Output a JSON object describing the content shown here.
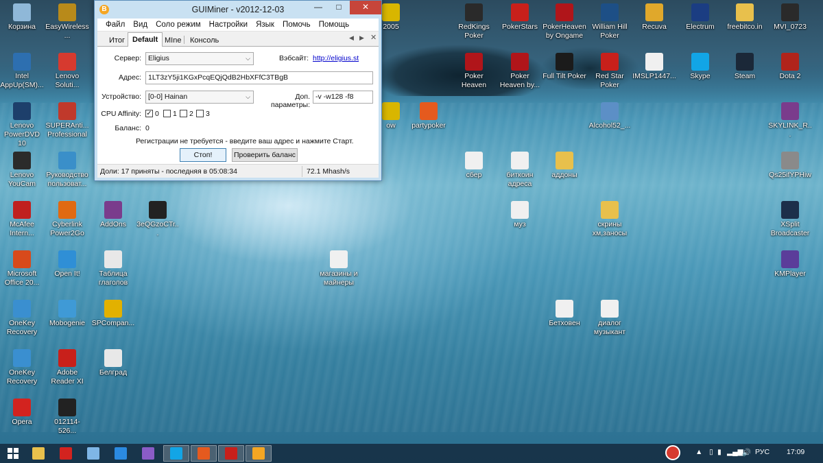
{
  "window": {
    "title": "GUIMiner - v2012-12-03",
    "menu": [
      "Файл",
      "Вид",
      "Соло режим",
      "Настройки",
      "Язык",
      "Помочь",
      "Помощь"
    ],
    "tabs": [
      "Итог",
      "Default",
      "MIne",
      "Консоль"
    ],
    "active_tab": "Default",
    "form": {
      "server_label": "Сервер:",
      "server_value": "Eligius",
      "website_label": "Вэбсайт:",
      "website_link": "http://eligius.st",
      "address_label": "Адрес:",
      "address_value": "1LT3zY5ji1KGxPcqEQjQdB2HbXFfC3TBgB",
      "device_label": "Устройство:",
      "device_value": "[0-0] Hainan",
      "extra_label": "Доп. параметры:",
      "extra_value": "-v -w128 -f8",
      "affinity_label": "CPU Affinity:",
      "affinity": [
        {
          "label": "0",
          "checked": true
        },
        {
          "label": "1",
          "checked": false
        },
        {
          "label": "2",
          "checked": false
        },
        {
          "label": "3",
          "checked": false
        }
      ],
      "balance_label": "Баланс:",
      "balance_value": "0",
      "note": "Регистрации не требуется - введите ваш адрес и нажмите Старт.",
      "stop_button": "Стоп!",
      "check_balance_button": "Проверить баланс"
    },
    "status": {
      "shares": "Доли: 17 приняты - последняя в 05:08:34",
      "hashrate": "72.1 Mhash/s"
    }
  },
  "desktop_icons": [
    {
      "label": "Корзина",
      "icon": "recycle-bin-icon",
      "color": "#8fb8d8"
    },
    {
      "label": "EasyWireless...",
      "icon": "wireless-app-icon",
      "color": "#b88a1a"
    },
    {
      "label": "Intel AppUp(SM)...",
      "icon": "intel-appup-icon",
      "color": "#2d6fb0"
    },
    {
      "label": "Lenovo Soluti...",
      "icon": "lenovo-solutions-icon",
      "color": "#d63a2f"
    },
    {
      "label": "Lenovo PowerDVD 10",
      "icon": "powerdvd-icon",
      "color": "#1d3f6b"
    },
    {
      "label": "SUPERAnti... Professional",
      "icon": "superantispyware-icon",
      "color": "#c0392b"
    },
    {
      "label": "Lenovo YouCam",
      "icon": "youcam-icon",
      "color": "#2b2b2b"
    },
    {
      "label": "Руководство пользоват...",
      "icon": "user-guide-icon",
      "color": "#3a8fc9"
    },
    {
      "label": "McAfee Intern...",
      "icon": "mcafee-icon",
      "color": "#c0201f"
    },
    {
      "label": "Cyberlink Power2Go",
      "icon": "power2go-icon",
      "color": "#e06a12"
    },
    {
      "label": "AddOns",
      "icon": "winrar-icon",
      "color": "#7a3c8c"
    },
    {
      "label": "3eQGzoCTr...",
      "icon": "video-file-icon",
      "color": "#222222"
    },
    {
      "label": "Microsoft Office 20...",
      "icon": "office-icon",
      "color": "#d84a1b"
    },
    {
      "label": "Open It!",
      "icon": "open-it-icon",
      "color": "#2f8fd6"
    },
    {
      "label": "Таблица глаголов",
      "icon": "image-file-icon",
      "color": "#e8e8e8"
    },
    {
      "label": "OneKey Recovery",
      "icon": "onekey-recovery-icon",
      "color": "#3a8fd0"
    },
    {
      "label": "Mobogenie",
      "icon": "mobogenie-icon",
      "color": "#3f9ad6"
    },
    {
      "label": "SPCompan...",
      "icon": "spcompanion-icon",
      "color": "#e2b100"
    },
    {
      "label": "OneKey Recovery",
      "icon": "onekey-recovery-icon",
      "color": "#3a8fd0"
    },
    {
      "label": "Adobe Reader XI",
      "icon": "adobe-reader-icon",
      "color": "#c8201b"
    },
    {
      "label": "Белград",
      "icon": "image-file-icon",
      "color": "#e8e8e8"
    },
    {
      "label": "Opera",
      "icon": "opera-icon",
      "color": "#d3231f"
    },
    {
      "label": "012114-526...",
      "icon": "video-file-icon",
      "color": "#222222"
    },
    {
      "label": "2005",
      "icon": "app-icon",
      "color": "#d8b600"
    },
    {
      "label": "RedKings Poker",
      "icon": "redkings-icon",
      "color": "#2a2a2a"
    },
    {
      "label": "PokerStars",
      "icon": "pokerstars-icon",
      "color": "#c8201b"
    },
    {
      "label": "PokerHeaven by Ongame",
      "icon": "pokerheaven-icon",
      "color": "#b0151a"
    },
    {
      "label": "William Hill Poker",
      "icon": "williamhill-icon",
      "color": "#1d4f86"
    },
    {
      "label": "Recuva",
      "icon": "recuva-icon",
      "color": "#e0a82b"
    },
    {
      "label": "Electrum",
      "icon": "electrum-icon",
      "color": "#1b3d82"
    },
    {
      "label": "freebitco.in",
      "icon": "folder-icon",
      "color": "#e8c04c"
    },
    {
      "label": "MVI_0723",
      "icon": "video-file-icon",
      "color": "#2a2a2a"
    },
    {
      "label": "Poker Heaven",
      "icon": "pokerheaven-icon",
      "color": "#b0151a"
    },
    {
      "label": "Poker Heaven by...",
      "icon": "pokerheaven-icon",
      "color": "#b0151a"
    },
    {
      "label": "Full Tilt Poker",
      "icon": "fulltilt-icon",
      "color": "#1b1b1b"
    },
    {
      "label": "Red Star Poker",
      "icon": "redstar-icon",
      "color": "#c8201b"
    },
    {
      "label": "IMSLP1447...",
      "icon": "document-icon",
      "color": "#f0f0f0"
    },
    {
      "label": "Skype",
      "icon": "skype-icon",
      "color": "#12a5e6"
    },
    {
      "label": "Steam",
      "icon": "steam-icon",
      "color": "#1b2838"
    },
    {
      "label": "Dota 2",
      "icon": "dota2-icon",
      "color": "#b0241b"
    },
    {
      "label": "ow",
      "icon": "app-icon",
      "color": "#d8b600"
    },
    {
      "label": "partypoker",
      "icon": "partypoker-icon",
      "color": "#e55a1e"
    },
    {
      "label": "Alcohol52_...",
      "icon": "setup-icon",
      "color": "#5c8fc6"
    },
    {
      "label": "SKYLINK_R...",
      "icon": "winrar-icon",
      "color": "#7a3c8c"
    },
    {
      "label": "сбер",
      "icon": "document-icon",
      "color": "#f0f0f0"
    },
    {
      "label": "биткоин адреса",
      "icon": "document-icon",
      "color": "#f0f0f0"
    },
    {
      "label": "аддоны",
      "icon": "folder-icon",
      "color": "#e8c04c"
    },
    {
      "label": "Qs25ifYPHiw",
      "icon": "video-file-icon",
      "color": "#8a8a8a"
    },
    {
      "label": "муз",
      "icon": "document-icon",
      "color": "#f0f0f0"
    },
    {
      "label": "скрины хм,заносы",
      "icon": "folder-icon",
      "color": "#e8c04c"
    },
    {
      "label": "XSplit Broadcaster",
      "icon": "xsplit-icon",
      "color": "#1c2f4a"
    },
    {
      "label": "магазины и майнеры",
      "icon": "document-icon",
      "color": "#f0f0f0"
    },
    {
      "label": "KMPlayer",
      "icon": "kmplayer-icon",
      "color": "#5b3d9a"
    },
    {
      "label": "Бетховен",
      "icon": "document-icon",
      "color": "#f0f0f0"
    },
    {
      "label": "диалог музыкант",
      "icon": "document-icon",
      "color": "#f0f0f0"
    }
  ],
  "taskbar": {
    "items": [
      {
        "icon": "windows-icon",
        "color": "#ffffff"
      },
      {
        "icon": "file-explorer-icon",
        "color": "#e8c04c"
      },
      {
        "icon": "opera-icon",
        "color": "#d3231f"
      },
      {
        "icon": "computer-icon",
        "color": "#7fb6e6"
      },
      {
        "icon": "internet-explorer-icon",
        "color": "#2b8ae0"
      },
      {
        "icon": "visual-studio-icon",
        "color": "#8a5cc7"
      },
      {
        "icon": "skype-icon",
        "color": "#12a5e6"
      },
      {
        "icon": "partypoker-icon",
        "color": "#e55a1e"
      },
      {
        "icon": "pokerstars-icon",
        "color": "#c8201b"
      },
      {
        "icon": "bitcoin-icon",
        "color": "#f5a623"
      }
    ],
    "language": "РУС",
    "clock": "17:09"
  }
}
